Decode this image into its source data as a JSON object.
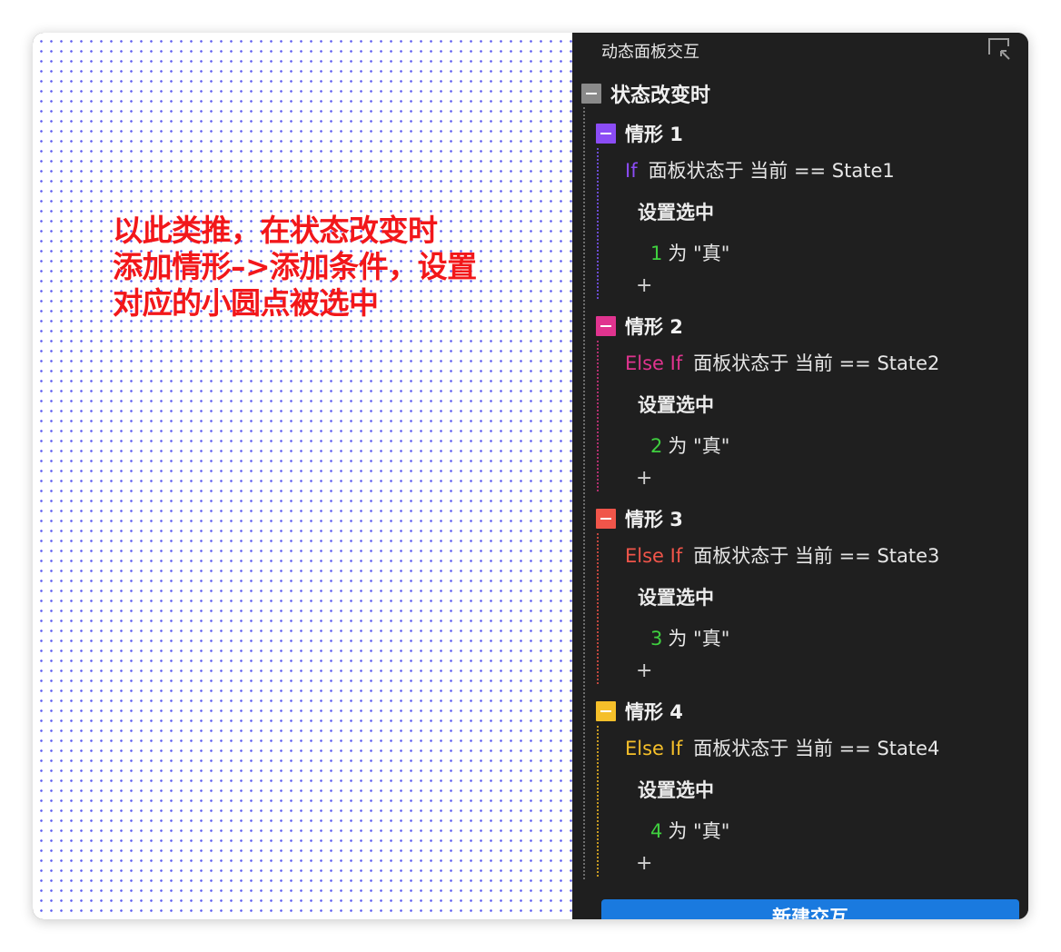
{
  "annotation": {
    "text": "以此类推，在状态改变时\n添加情形–>添加条件，设置\n对应的小圆点被选中",
    "color": "#f2171a"
  },
  "panel": {
    "title": "动态面板交互",
    "collapse_icon": "collapse-panel-icon",
    "event": {
      "label": "状态改变时",
      "toggle_color": "#8a8a8a"
    },
    "cases": [
      {
        "label": "情形 1",
        "color": "#8b4cf5",
        "keyword": "If",
        "condition": "面板状态于 当前 == State1",
        "action": "设置选中",
        "target_num": "1",
        "target_rest": "为 \"真\"",
        "add": "+"
      },
      {
        "label": "情形 2",
        "color": "#e0348f",
        "keyword": "Else If",
        "condition": "面板状态于 当前 == State2",
        "action": "设置选中",
        "target_num": "2",
        "target_rest": "为 \"真\"",
        "add": "+"
      },
      {
        "label": "情形 3",
        "color": "#f0554a",
        "keyword": "Else If",
        "condition": "面板状态于 当前 == State3",
        "action": "设置选中",
        "target_num": "3",
        "target_rest": "为 \"真\"",
        "add": "+"
      },
      {
        "label": "情形 4",
        "color": "#f5bf2a",
        "keyword": "Else If",
        "condition": "面板状态于 当前 == State4",
        "action": "设置选中",
        "target_num": "4",
        "target_rest": "为 \"真\"",
        "add": "+"
      }
    ],
    "new_button_label": "新建交互",
    "button_color": "#1a7adf"
  }
}
